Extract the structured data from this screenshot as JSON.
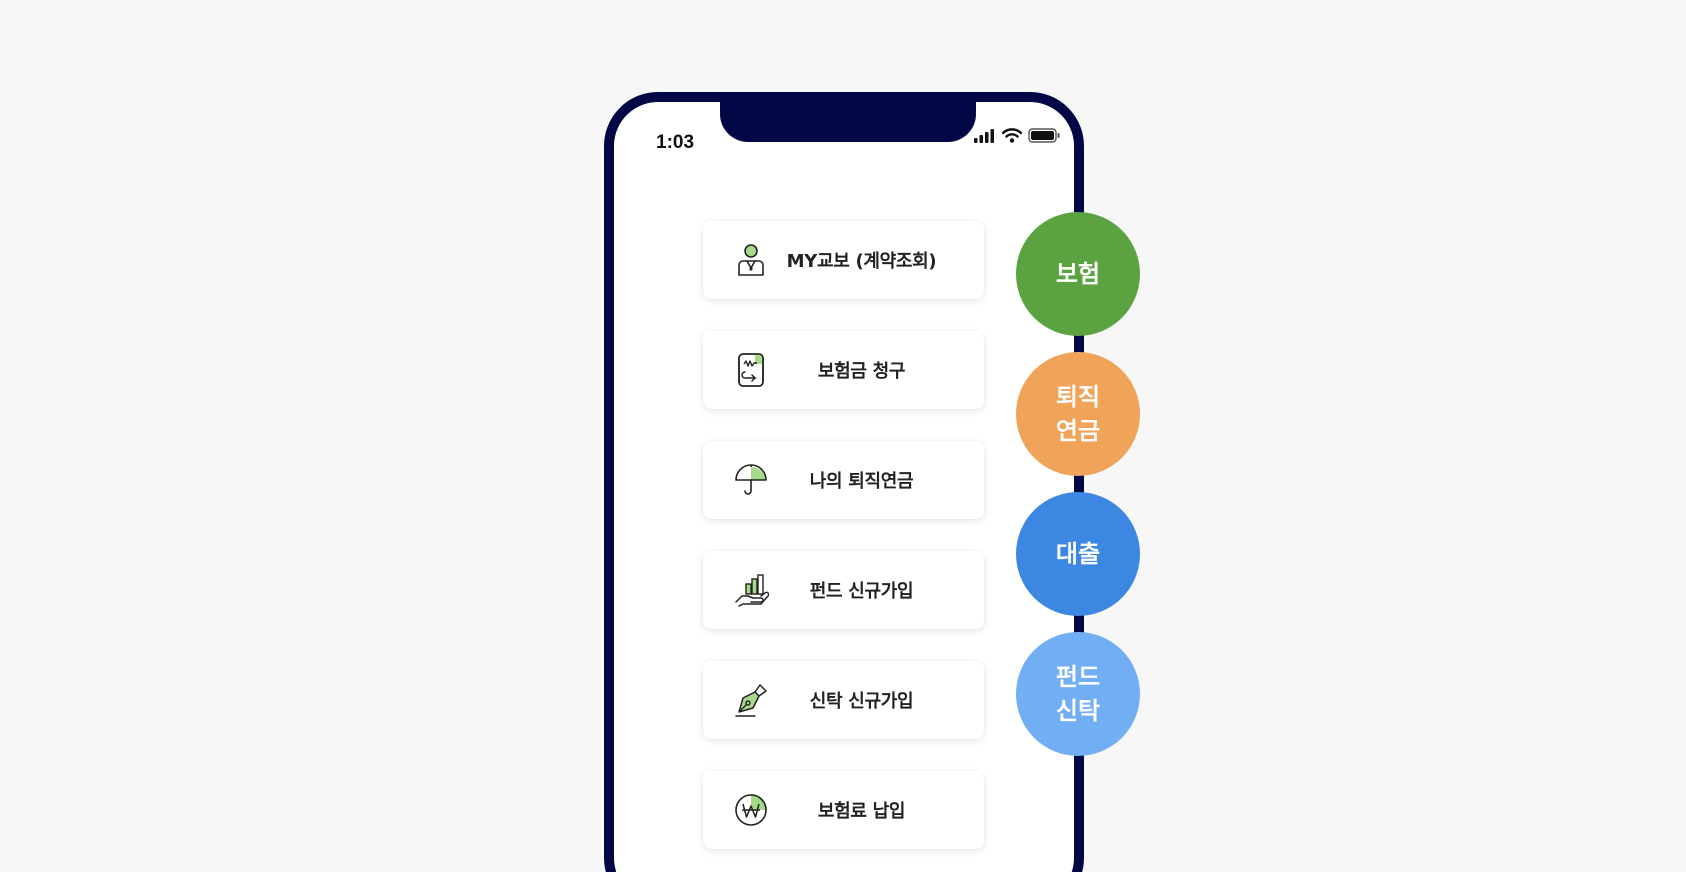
{
  "status_bar": {
    "time": "1:03"
  },
  "menu": {
    "items": [
      {
        "label": "MY교보 (계약조회)",
        "icon": "person-icon"
      },
      {
        "label": "보험금 청구",
        "icon": "claim-document-icon"
      },
      {
        "label": "나의 퇴직연금",
        "icon": "umbrella-icon"
      },
      {
        "label": "펀드 신규가입",
        "icon": "hand-chart-icon"
      },
      {
        "label": "신탁 신규가입",
        "icon": "pen-nib-icon"
      },
      {
        "label": "보험료 납입",
        "icon": "won-coin-icon"
      }
    ]
  },
  "categories": [
    {
      "label": "보험",
      "color": "#5ba240"
    },
    {
      "label": "퇴직\n연금",
      "color": "#f0a45a"
    },
    {
      "label": "대출",
      "color": "#3b87e2"
    },
    {
      "label": "펀드\n신탁",
      "color": "#71aef3"
    }
  ],
  "colors": {
    "frame": "#020746",
    "accent_green": "#a6da8a",
    "background": "#f7f7f8"
  }
}
